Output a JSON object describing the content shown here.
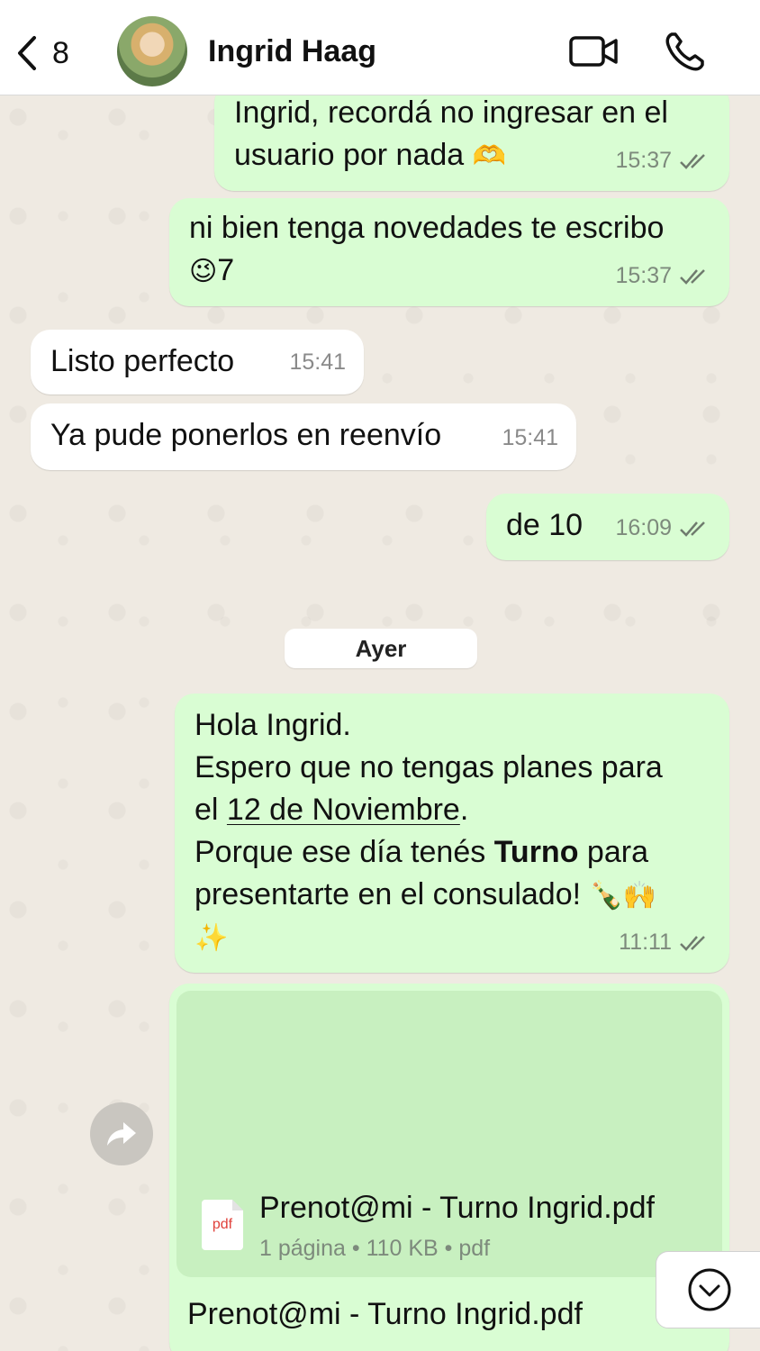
{
  "header": {
    "back_count": "8",
    "contact_name": "Ingrid Haag"
  },
  "messages": [
    {
      "dir": "out",
      "lines": [
        "Ingrid, recordá no ingresar en el",
        "usuario por nada"
      ],
      "emoji": "🫶",
      "time": "15:37"
    },
    {
      "dir": "out",
      "lines": [
        "ni bien tenga novedades te escribo"
      ],
      "emoji": "😉",
      "suffix": "7",
      "time": "15:37"
    },
    {
      "dir": "in",
      "text": "Listo perfecto",
      "time": "15:41"
    },
    {
      "dir": "in",
      "text": "Ya pude ponerlos en reenvío",
      "time": "15:41"
    },
    {
      "dir": "out",
      "text": "de 10",
      "time": "16:09"
    }
  ],
  "day_divider": "Ayer",
  "long_message": {
    "line1": "Hola Ingrid.",
    "line2": "Espero que no tengas planes para",
    "line3_pre": "el ",
    "line3_link": "12 de Noviembre",
    "line3_post": ".",
    "line4_pre": "Porque ese día tenés ",
    "line4_bold": "Turno",
    "line4_post": " para",
    "line5": "presentarte en el consulado!",
    "emoji_end": "🍾🙌",
    "emoji_line": "✨",
    "time": "11:11"
  },
  "document": {
    "file_type_label": "pdf",
    "file_name": "Prenot@mi - Turno Ingrid.pdf",
    "info": "1 página • 110 KB • pdf",
    "caption": "Prenot@mi - Turno Ingrid.pdf"
  },
  "colors": {
    "outgoing_bubble": "#d9fdd3",
    "incoming_bubble": "#ffffff",
    "read_ticks": "#7d8a7c"
  },
  "icons": [
    "chevron-left-icon",
    "video-call-icon",
    "phone-icon",
    "double-check-icon",
    "forward-icon",
    "chevron-down-icon"
  ]
}
